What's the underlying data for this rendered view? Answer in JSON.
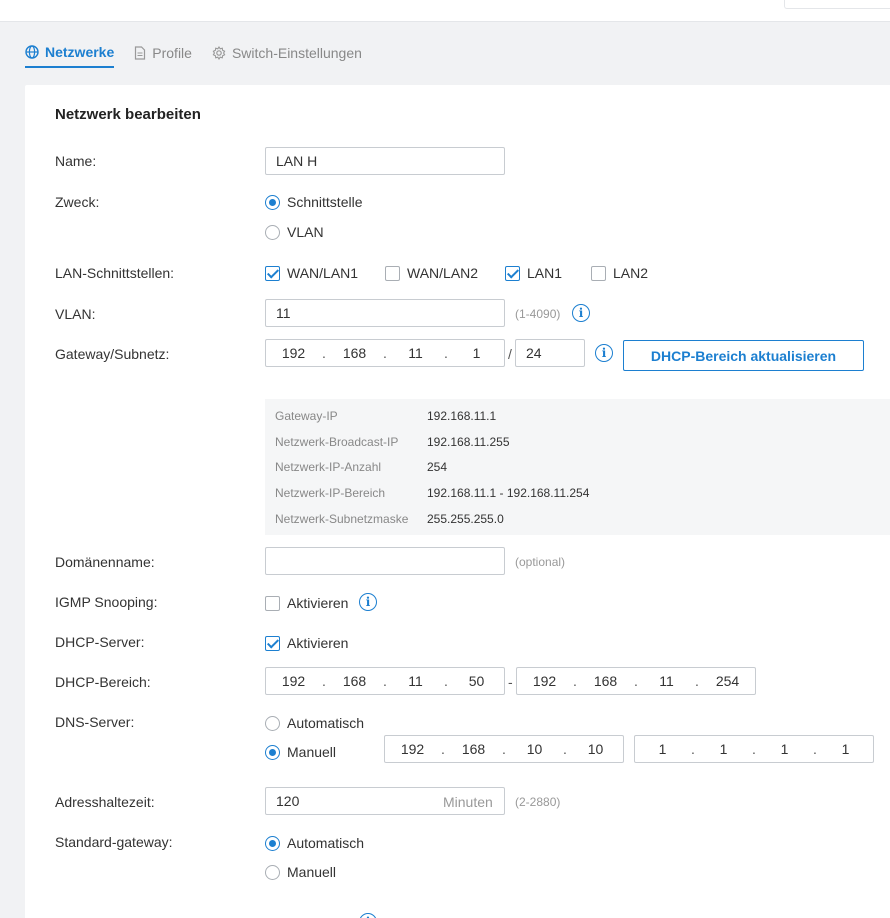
{
  "tabs": [
    {
      "label": "Netzwerke",
      "icon": "globe-icon",
      "active": true
    },
    {
      "label": "Profile",
      "icon": "document-icon",
      "active": false
    },
    {
      "label": "Switch-Einstellungen",
      "icon": "gear-icon",
      "active": false
    }
  ],
  "form": {
    "title": "Netzwerk bearbeiten",
    "name": {
      "label": "Name:",
      "value": "LAN H"
    },
    "zweck": {
      "label": "Zweck:",
      "options": [
        "Schnittstelle",
        "VLAN"
      ],
      "selected": "Schnittstelle"
    },
    "lan_interfaces": {
      "label": "LAN-Schnittstellen:",
      "items": [
        {
          "label": "WAN/LAN1",
          "checked": true
        },
        {
          "label": "WAN/LAN2",
          "checked": false
        },
        {
          "label": "LAN1",
          "checked": true
        },
        {
          "label": "LAN2",
          "checked": false
        }
      ]
    },
    "vlan": {
      "label": "VLAN:",
      "value": "11",
      "hint": "(1-4090)"
    },
    "gateway": {
      "label": "Gateway/Subnetz:",
      "octets": [
        "192",
        "168",
        "11",
        "1"
      ],
      "separator": "/",
      "mask": "24",
      "button": "DHCP-Bereich aktualisieren"
    },
    "summary": [
      {
        "key": "Gateway-IP",
        "value": "192.168.11.1"
      },
      {
        "key": "Netzwerk-Broadcast-IP",
        "value": "192.168.11.255"
      },
      {
        "key": "Netzwerk-IP-Anzahl",
        "value": "254"
      },
      {
        "key": "Netzwerk-IP-Bereich",
        "value": "192.168.11.1 - 192.168.11.254"
      },
      {
        "key": "Netzwerk-Subnetzmaske",
        "value": "255.255.255.0"
      }
    ],
    "domain": {
      "label": "Domänenname:",
      "value": "",
      "hint": "(optional)"
    },
    "igmp": {
      "label": "IGMP Snooping:",
      "option": "Aktivieren",
      "checked": false
    },
    "dhcp_server": {
      "label": "DHCP-Server:",
      "option": "Aktivieren",
      "checked": true
    },
    "dhcp_range": {
      "label": "DHCP-Bereich:",
      "start": [
        "192",
        "168",
        "11",
        "50"
      ],
      "separator": "-",
      "end": [
        "192",
        "168",
        "11",
        "254"
      ]
    },
    "dns": {
      "label": "DNS-Server:",
      "options": [
        "Automatisch",
        "Manuell"
      ],
      "selected": "Manuell",
      "primary": [
        "192",
        "168",
        "10",
        "10"
      ],
      "secondary": [
        "1",
        "1",
        "1",
        "1"
      ]
    },
    "lease": {
      "label": "Adresshaltezeit:",
      "value": "120",
      "unit": "Minuten",
      "hint": "(2-2880)"
    },
    "std_gateway": {
      "label": "Standard-gateway:",
      "options": [
        "Automatisch",
        "Manuell"
      ],
      "selected": "Automatisch"
    }
  },
  "colors": {
    "accent": "#1c7fd0"
  }
}
